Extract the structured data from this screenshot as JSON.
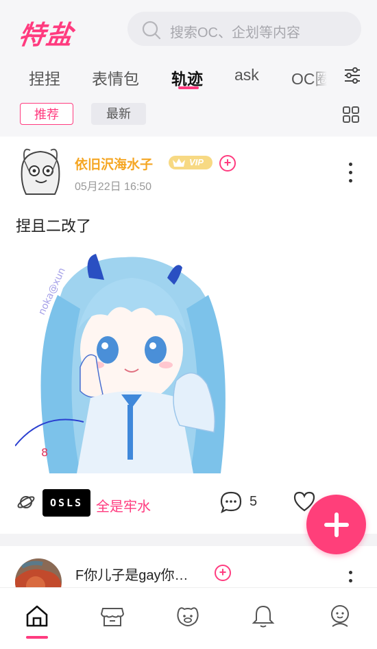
{
  "app": {
    "logo": "特盐"
  },
  "search": {
    "placeholder": "搜索OC、企划等内容"
  },
  "tabs": [
    {
      "label": "捏捏",
      "active": false
    },
    {
      "label": "表情包",
      "active": false
    },
    {
      "label": "轨迹",
      "active": true
    },
    {
      "label": "ask",
      "active": false
    },
    {
      "label": "OC圈",
      "active": false
    }
  ],
  "sort": {
    "recommended": "推荐",
    "latest": "最新",
    "selected": "推荐"
  },
  "posts": [
    {
      "username": "依旧沢海水子",
      "vip_label": "VIP",
      "date": "05月22日 16:50",
      "text": "捏且二改了",
      "image_watermark": "noka@xun",
      "circle_badge": "OSLS",
      "circle_name": "全是牢水",
      "comment_count": "5"
    },
    {
      "username": "F你儿子是gay你…"
    }
  ],
  "colors": {
    "accent": "#ff3b7f",
    "vip": "#f5a623",
    "background": "#f6f6f8"
  },
  "icons": [
    "search-icon",
    "filter-icon",
    "grid-icon",
    "add-icon",
    "more-icon",
    "planet-icon",
    "comment-icon",
    "heart-icon",
    "home-icon",
    "shop-icon",
    "pet-icon",
    "bell-icon",
    "profile-icon"
  ],
  "bottom_nav": {
    "selected": "home"
  }
}
